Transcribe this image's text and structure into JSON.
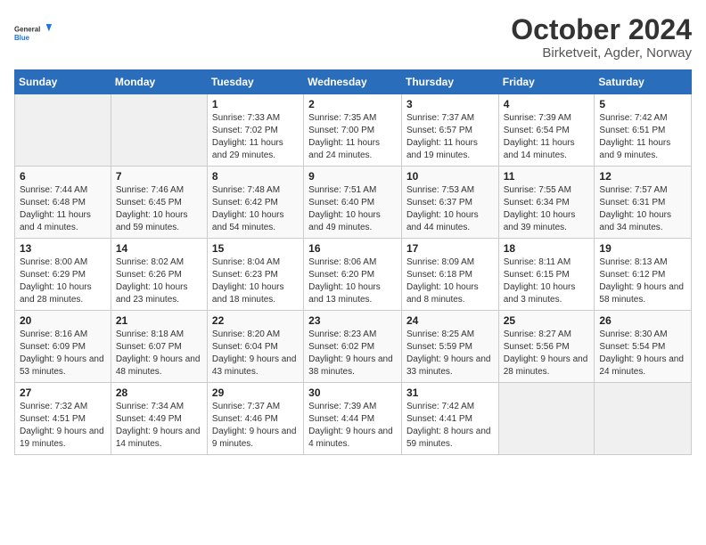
{
  "header": {
    "logo_general": "General",
    "logo_blue": "Blue",
    "title": "October 2024",
    "location": "Birketveit, Agder, Norway"
  },
  "calendar": {
    "days_of_week": [
      "Sunday",
      "Monday",
      "Tuesday",
      "Wednesday",
      "Thursday",
      "Friday",
      "Saturday"
    ],
    "weeks": [
      [
        {
          "day": "",
          "info": ""
        },
        {
          "day": "",
          "info": ""
        },
        {
          "day": "1",
          "info": "Sunrise: 7:33 AM\nSunset: 7:02 PM\nDaylight: 11 hours and 29 minutes."
        },
        {
          "day": "2",
          "info": "Sunrise: 7:35 AM\nSunset: 7:00 PM\nDaylight: 11 hours and 24 minutes."
        },
        {
          "day": "3",
          "info": "Sunrise: 7:37 AM\nSunset: 6:57 PM\nDaylight: 11 hours and 19 minutes."
        },
        {
          "day": "4",
          "info": "Sunrise: 7:39 AM\nSunset: 6:54 PM\nDaylight: 11 hours and 14 minutes."
        },
        {
          "day": "5",
          "info": "Sunrise: 7:42 AM\nSunset: 6:51 PM\nDaylight: 11 hours and 9 minutes."
        }
      ],
      [
        {
          "day": "6",
          "info": "Sunrise: 7:44 AM\nSunset: 6:48 PM\nDaylight: 11 hours and 4 minutes."
        },
        {
          "day": "7",
          "info": "Sunrise: 7:46 AM\nSunset: 6:45 PM\nDaylight: 10 hours and 59 minutes."
        },
        {
          "day": "8",
          "info": "Sunrise: 7:48 AM\nSunset: 6:42 PM\nDaylight: 10 hours and 54 minutes."
        },
        {
          "day": "9",
          "info": "Sunrise: 7:51 AM\nSunset: 6:40 PM\nDaylight: 10 hours and 49 minutes."
        },
        {
          "day": "10",
          "info": "Sunrise: 7:53 AM\nSunset: 6:37 PM\nDaylight: 10 hours and 44 minutes."
        },
        {
          "day": "11",
          "info": "Sunrise: 7:55 AM\nSunset: 6:34 PM\nDaylight: 10 hours and 39 minutes."
        },
        {
          "day": "12",
          "info": "Sunrise: 7:57 AM\nSunset: 6:31 PM\nDaylight: 10 hours and 34 minutes."
        }
      ],
      [
        {
          "day": "13",
          "info": "Sunrise: 8:00 AM\nSunset: 6:29 PM\nDaylight: 10 hours and 28 minutes."
        },
        {
          "day": "14",
          "info": "Sunrise: 8:02 AM\nSunset: 6:26 PM\nDaylight: 10 hours and 23 minutes."
        },
        {
          "day": "15",
          "info": "Sunrise: 8:04 AM\nSunset: 6:23 PM\nDaylight: 10 hours and 18 minutes."
        },
        {
          "day": "16",
          "info": "Sunrise: 8:06 AM\nSunset: 6:20 PM\nDaylight: 10 hours and 13 minutes."
        },
        {
          "day": "17",
          "info": "Sunrise: 8:09 AM\nSunset: 6:18 PM\nDaylight: 10 hours and 8 minutes."
        },
        {
          "day": "18",
          "info": "Sunrise: 8:11 AM\nSunset: 6:15 PM\nDaylight: 10 hours and 3 minutes."
        },
        {
          "day": "19",
          "info": "Sunrise: 8:13 AM\nSunset: 6:12 PM\nDaylight: 9 hours and 58 minutes."
        }
      ],
      [
        {
          "day": "20",
          "info": "Sunrise: 8:16 AM\nSunset: 6:09 PM\nDaylight: 9 hours and 53 minutes."
        },
        {
          "day": "21",
          "info": "Sunrise: 8:18 AM\nSunset: 6:07 PM\nDaylight: 9 hours and 48 minutes."
        },
        {
          "day": "22",
          "info": "Sunrise: 8:20 AM\nSunset: 6:04 PM\nDaylight: 9 hours and 43 minutes."
        },
        {
          "day": "23",
          "info": "Sunrise: 8:23 AM\nSunset: 6:02 PM\nDaylight: 9 hours and 38 minutes."
        },
        {
          "day": "24",
          "info": "Sunrise: 8:25 AM\nSunset: 5:59 PM\nDaylight: 9 hours and 33 minutes."
        },
        {
          "day": "25",
          "info": "Sunrise: 8:27 AM\nSunset: 5:56 PM\nDaylight: 9 hours and 28 minutes."
        },
        {
          "day": "26",
          "info": "Sunrise: 8:30 AM\nSunset: 5:54 PM\nDaylight: 9 hours and 24 minutes."
        }
      ],
      [
        {
          "day": "27",
          "info": "Sunrise: 7:32 AM\nSunset: 4:51 PM\nDaylight: 9 hours and 19 minutes."
        },
        {
          "day": "28",
          "info": "Sunrise: 7:34 AM\nSunset: 4:49 PM\nDaylight: 9 hours and 14 minutes."
        },
        {
          "day": "29",
          "info": "Sunrise: 7:37 AM\nSunset: 4:46 PM\nDaylight: 9 hours and 9 minutes."
        },
        {
          "day": "30",
          "info": "Sunrise: 7:39 AM\nSunset: 4:44 PM\nDaylight: 9 hours and 4 minutes."
        },
        {
          "day": "31",
          "info": "Sunrise: 7:42 AM\nSunset: 4:41 PM\nDaylight: 8 hours and 59 minutes."
        },
        {
          "day": "",
          "info": ""
        },
        {
          "day": "",
          "info": ""
        }
      ]
    ]
  }
}
